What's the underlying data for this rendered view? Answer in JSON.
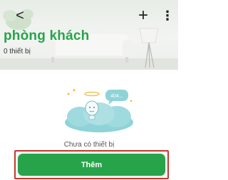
{
  "header": {
    "back_icon": "back-arrow-icon",
    "back_glyph": "<",
    "add_icon": "plus-icon",
    "add_glyph": "+",
    "more_icon": "more-vertical-icon",
    "more_glyph": "⋮",
    "room_name": "phòng khách",
    "device_count": "0 thiết bị"
  },
  "empty_state": {
    "illustration_icon": "empty-404-illustration",
    "bubble_text": "404...",
    "message": "Chưa có thiết bị"
  },
  "actions": {
    "add_label": "Thêm"
  },
  "colors": {
    "accent": "#27a44a",
    "highlight": "#c0392b"
  }
}
